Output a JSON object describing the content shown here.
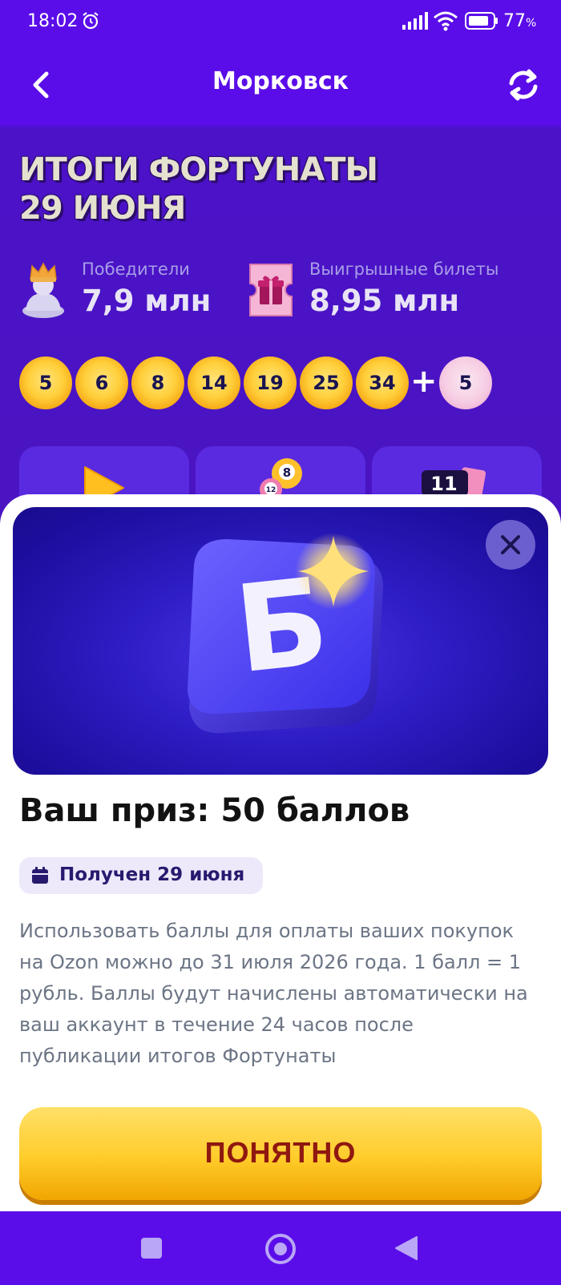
{
  "status_bar": {
    "time": "18:02",
    "battery": "77",
    "battery_unit": "%"
  },
  "header": {
    "title": "Морковск"
  },
  "results": {
    "title_line1": "ИТОГИ ФОРТУНАТЫ",
    "title_line2": "29 ИЮНЯ",
    "winners_label": "Победители",
    "winners_value": "7,9 млн",
    "tickets_label": "Выигрышные билеты",
    "tickets_value": "8,95 млн",
    "numbers": [
      "5",
      "6",
      "8",
      "14",
      "19",
      "25",
      "34"
    ],
    "plus": "+",
    "bonus_number": "5"
  },
  "tiles": {
    "ball_8": "8",
    "ball_12": "12",
    "ticket_count": "11"
  },
  "sheet": {
    "prize_title": "Ваш приз: 50 баллов",
    "received_label": "Получен 29 июня",
    "description": "Использовать баллы для оплаты ваших покупок на Ozon можно до 31 июля 2026 года. 1 балл = 1 рубль. Баллы будут начислены автоматически на ваш аккаунт в течение 24 часов после публикации итогов Фортунаты",
    "ok_label": "ПОНЯТНО",
    "badge_letter": "Б"
  },
  "colors": {
    "background": "#5a0de8",
    "accent_yellow": "#ffcc2a",
    "button_text": "#8f1810",
    "banner_blue": "#2f1ec6"
  },
  "icons": [
    "back-icon",
    "refresh-icon",
    "crown-icon",
    "ticket-gift-icon",
    "close-icon",
    "calendar-icon",
    "sparkle-icon"
  ]
}
